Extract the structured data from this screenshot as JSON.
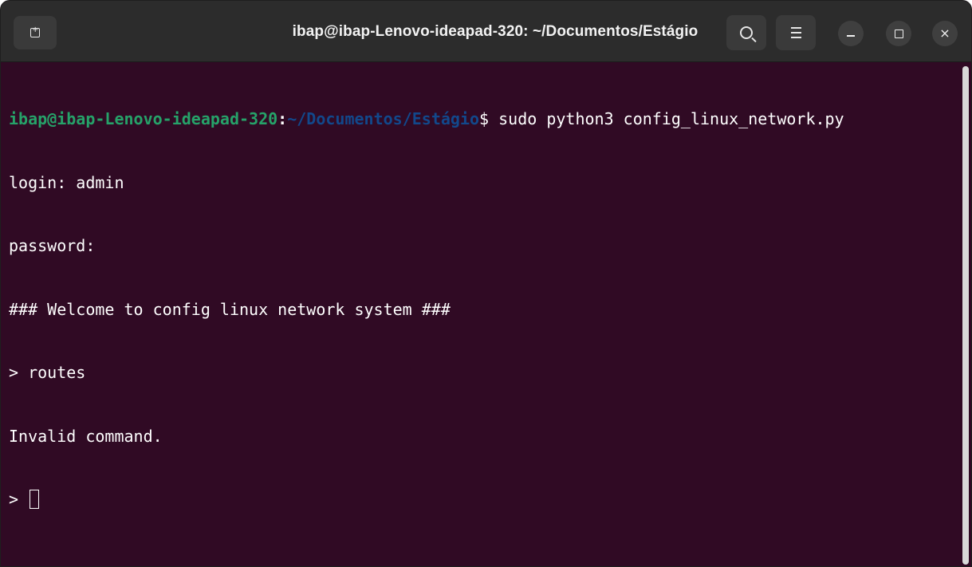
{
  "window": {
    "title": "ibap@ibap-Lenovo-ideapad-320: ~/Documentos/Estágio",
    "background_color": "#300a24"
  },
  "titlebar": {
    "new_tab_icon": "new-tab-icon",
    "search_icon": "search-icon",
    "menu_icon": "hamburger-menu-icon",
    "minimize_icon": "minimize-icon",
    "maximize_icon": "maximize-icon",
    "close_icon": "close-icon",
    "close_glyph": "×"
  },
  "terminal": {
    "prompt_user": "ibap@ibap-Lenovo-ideapad-320",
    "prompt_colon": ":",
    "prompt_path": "~/Documentos/Estágio",
    "prompt_symbol": "$ ",
    "command": "sudo python3 config_linux_network.py",
    "output_lines": [
      "login: admin",
      "password:",
      "### Welcome to config linux network system ###",
      "> routes",
      "Invalid command."
    ],
    "current_prompt": "> ",
    "colors": {
      "user": "#26a269",
      "path": "#12488b",
      "text": "#ffffff"
    }
  }
}
